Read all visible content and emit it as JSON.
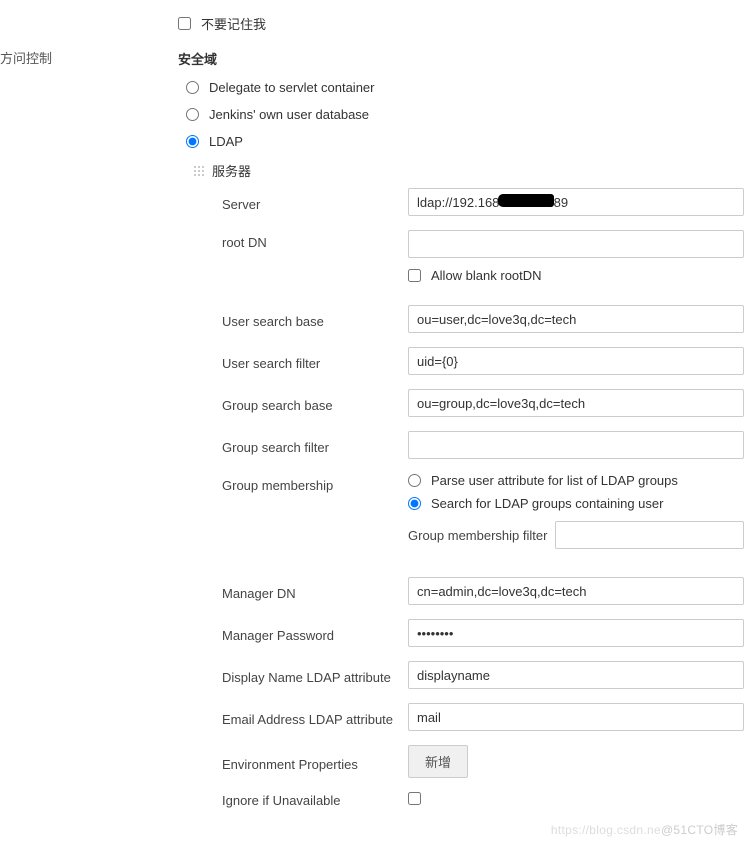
{
  "sidebar": {
    "access_control": "方问控制"
  },
  "remember": {
    "label": "不要记住我",
    "checked": false
  },
  "security_realm_title": "安全域",
  "realms": {
    "servlet": {
      "label": "Delegate to servlet container",
      "selected": false
    },
    "jenkins": {
      "label": "Jenkins' own user database",
      "selected": false
    },
    "ldap": {
      "label": "LDAP",
      "selected": true
    }
  },
  "ldap": {
    "servers_label": "服务器",
    "fields": {
      "server": {
        "label": "Server",
        "value": "ldap://192.168            :389"
      },
      "root_dn": {
        "label": "root DN",
        "value": ""
      },
      "allow_blank_root_dn": {
        "label": "Allow blank rootDN",
        "checked": false
      },
      "user_search_base": {
        "label": "User search base",
        "value": "ou=user,dc=love3q,dc=tech"
      },
      "user_search_filter": {
        "label": "User search filter",
        "value": "uid={0}"
      },
      "group_search_base": {
        "label": "Group search base",
        "value": "ou=group,dc=love3q,dc=tech"
      },
      "group_search_filter": {
        "label": "Group search filter",
        "value": ""
      },
      "group_membership": {
        "label": "Group membership",
        "options": {
          "parse": {
            "label": "Parse user attribute for list of LDAP groups",
            "selected": false
          },
          "search": {
            "label": "Search for LDAP groups containing user",
            "selected": true
          }
        },
        "filter_label": "Group membership filter",
        "filter_value": ""
      },
      "manager_dn": {
        "label": "Manager DN",
        "value": "cn=admin,dc=love3q,dc=tech"
      },
      "manager_password": {
        "label": "Manager Password",
        "value": "••••••••"
      },
      "display_name_attr": {
        "label": "Display Name LDAP attribute",
        "value": "displayname"
      },
      "email_attr": {
        "label": "Email Address LDAP attribute",
        "value": "mail"
      },
      "env_props": {
        "label": "Environment Properties",
        "button": "新增"
      },
      "ignore_unavailable": {
        "label": "Ignore if Unavailable",
        "checked": false
      }
    }
  },
  "watermark": {
    "left": "https://blog.csdn.ne",
    "right": "@51CTO博客"
  }
}
